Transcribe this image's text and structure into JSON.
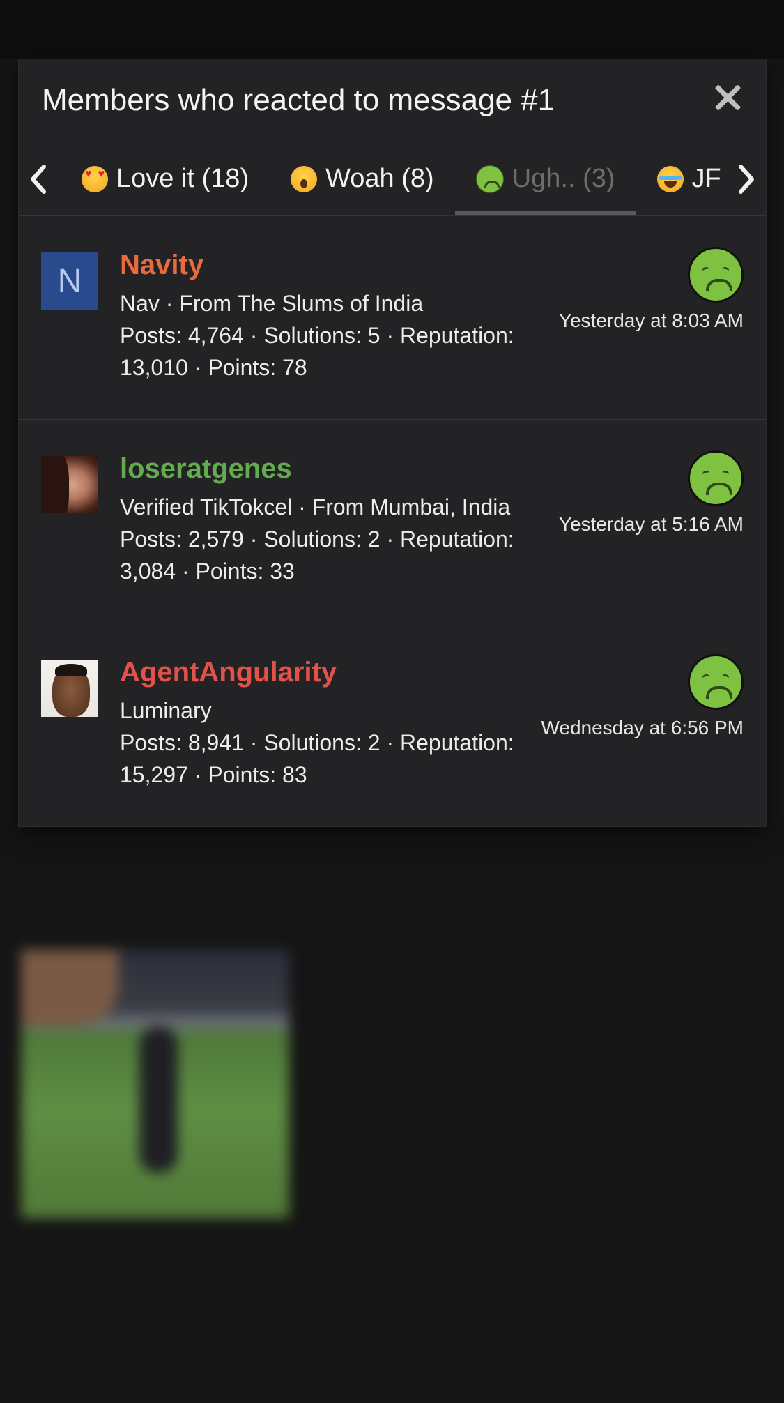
{
  "modal": {
    "title": "Members who reacted to message #1",
    "close_icon": "close-icon"
  },
  "tabs": [
    {
      "label": "Love it (18)",
      "icon": "heart-eyes-emoji-icon"
    },
    {
      "label": "Woah (8)",
      "icon": "astonished-emoji-icon"
    },
    {
      "label": "Ugh.. (3)",
      "icon": "nauseated-emoji-icon",
      "active": true
    },
    {
      "label": "JF",
      "icon": "tears-of-joy-emoji-icon"
    }
  ],
  "members": [
    {
      "name": "Navity",
      "avatar_letter": "N",
      "title": "Nav · From The Slums of India",
      "stats": "Posts: 4,764 · Solutions: 5 · Reputation: 13,010 · Points: 78",
      "time": "Yesterday at 8:03 AM"
    },
    {
      "name": "loseratgenes",
      "title": "Verified TikTokcel · From Mumbai, India",
      "stats": "Posts: 2,579 · Solutions: 2 · Reputation: 3,084 · Points: 33",
      "time": "Yesterday at 5:16 AM"
    },
    {
      "name": "AgentAngularity",
      "title": "Luminary",
      "stats": "Posts: 8,941 · Solutions: 2 · Reputation: 15,297 · Points: 83",
      "time": "Wednesday at 6:56 PM"
    }
  ],
  "colors": {
    "name_navity": "#ea6a3e",
    "name_loseratgenes": "#62ab4e",
    "name_agentangularity": "#e2524a",
    "modal_bg": "#232325"
  }
}
